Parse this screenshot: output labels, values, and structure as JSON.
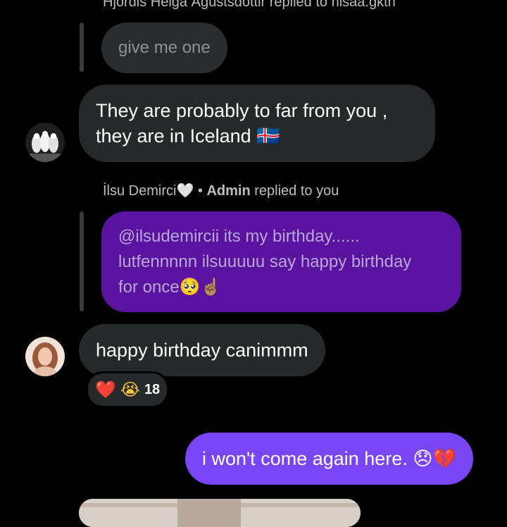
{
  "thread": {
    "reply_header_1": "Hjördis Helga Ágústsdóttir replied to nisaa.gktn",
    "quoted_1": "give me one",
    "message_1_line1": "They are probably to far from you ,",
    "message_1_line2": "they are in Iceland 🇮🇸",
    "reply_header_2_name": "İlsu Demirci🤍",
    "reply_header_2_sep": " • ",
    "reply_header_2_role": "Admin",
    "reply_header_2_tail": " replied to you",
    "quoted_2_line1": "@ilsudemircii its my birthday......",
    "quoted_2_line2": "lutfennnnn ilsuuuuu say happy birthday",
    "quoted_2_line3": "for once🥺☝🏽",
    "message_2": "happy birthday canimmm",
    "reaction_heart": "❤️",
    "reaction_cry": "😭",
    "reaction_count": "18",
    "outgoing_message": "i won't come again here. 😞💔"
  },
  "colors": {
    "background": "#000000",
    "incoming_bubble": "#26292a",
    "quoted_purple": "#5a139f",
    "outgoing_bubble": "#7a45f4"
  },
  "icons": {
    "avatar_1": "wolves-avatar",
    "avatar_2": "woman-avatar"
  }
}
